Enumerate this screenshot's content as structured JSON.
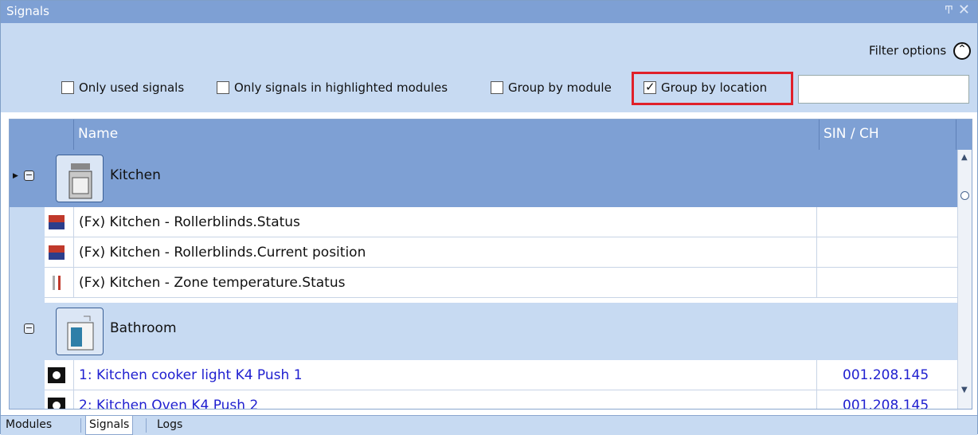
{
  "window": {
    "title": "Signals",
    "pin": "Ͳ",
    "close": "✕"
  },
  "filter": {
    "options_label": "Filter options",
    "only_used": "Only used signals",
    "only_highlighted": "Only signals in highlighted modules",
    "group_module": "Group by module",
    "group_location": "Group by location",
    "search_value": ""
  },
  "columns": {
    "name": "Name",
    "sin": "SIN / CH"
  },
  "groups": [
    {
      "label": "Kitchen"
    },
    {
      "label": "Bathroom"
    }
  ],
  "rows": [
    {
      "text": "(Fx) Kitchen - Rollerblinds.Status",
      "sin": ""
    },
    {
      "text": "(Fx) Kitchen - Rollerblinds.Current position",
      "sin": ""
    },
    {
      "text": "(Fx) Kitchen - Zone temperature.Status",
      "sin": ""
    },
    {
      "text": "1: Kitchen cooker light K4 Push 1",
      "sin": "001.208.145"
    },
    {
      "text": "2: Kitchen Oven K4 Push 2",
      "sin": "001.208.145"
    }
  ],
  "tabs": [
    "Modules",
    "Signals",
    "Logs"
  ],
  "colors": {
    "accent": "#7ea0d4",
    "panel": "#c7daf2",
    "highlight": "#e0202a",
    "link": "#2020d0"
  }
}
